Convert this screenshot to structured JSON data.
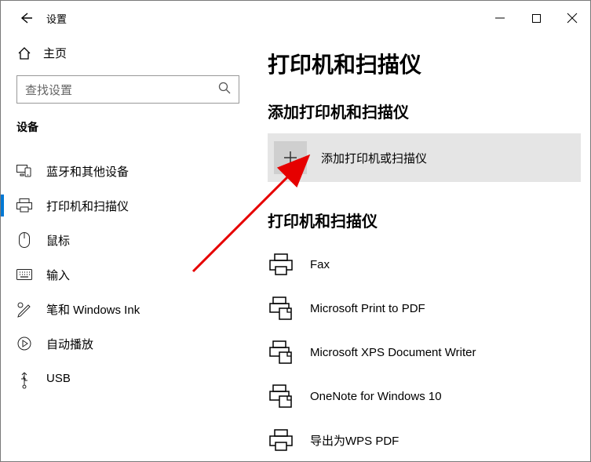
{
  "titlebar": {
    "title": "设置"
  },
  "sidebar": {
    "home": "主页",
    "search_placeholder": "查找设置",
    "section": "设备",
    "items": [
      {
        "label": "蓝牙和其他设备"
      },
      {
        "label": "打印机和扫描仪"
      },
      {
        "label": "鼠标"
      },
      {
        "label": "输入"
      },
      {
        "label": "笔和 Windows Ink"
      },
      {
        "label": "自动播放"
      },
      {
        "label": "USB"
      }
    ]
  },
  "main": {
    "h1": "打印机和扫描仪",
    "add_heading": "添加打印机和扫描仪",
    "add_label": "添加打印机或扫描仪",
    "list_heading": "打印机和扫描仪",
    "printers": [
      {
        "label": "Fax"
      },
      {
        "label": "Microsoft Print to PDF"
      },
      {
        "label": "Microsoft XPS Document Writer"
      },
      {
        "label": "OneNote for Windows 10"
      },
      {
        "label": "导出为WPS PDF"
      }
    ]
  }
}
